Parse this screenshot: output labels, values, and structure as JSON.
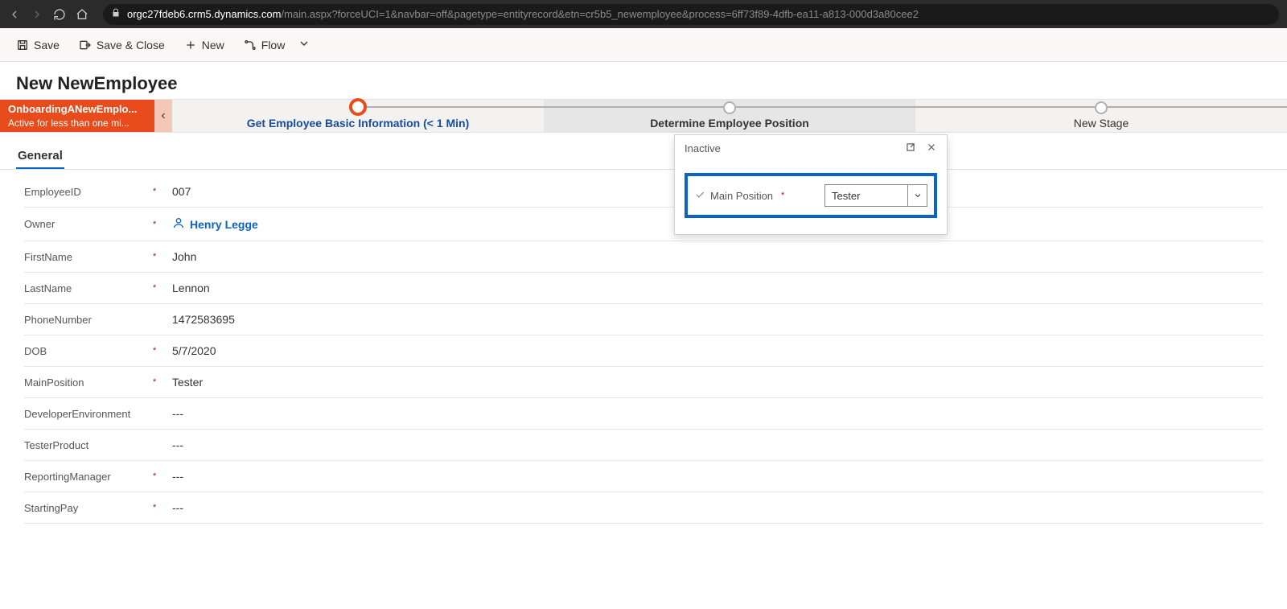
{
  "browser": {
    "url_domain": "orgc27fdeb6.crm5.dynamics.com",
    "url_path": "/main.aspx?forceUCI=1&navbar=off&pagetype=entityrecord&etn=cr5b5_newemployee&process=6ff73f89-4dfb-ea11-a813-000d3a80cee2"
  },
  "toolbar": {
    "save": "Save",
    "save_close": "Save & Close",
    "new": "New",
    "flow": "Flow"
  },
  "page_title": "New NewEmployee",
  "process": {
    "name": "OnboardingANewEmplo...",
    "status": "Active for less than one mi...",
    "stages": [
      {
        "label": "Get Employee Basic Information  (< 1 Min)",
        "state": "current"
      },
      {
        "label": "Determine Employee Position",
        "state": "active"
      },
      {
        "label": "New Stage",
        "state": "future"
      }
    ]
  },
  "stage_popup": {
    "status": "Inactive",
    "field_label": "Main Position",
    "field_value": "Tester"
  },
  "tabs": [
    {
      "label": "General",
      "active": true
    }
  ],
  "form": {
    "rows": [
      {
        "label": "EmployeeID",
        "required": true,
        "value": "007"
      },
      {
        "label": "Owner",
        "required": true,
        "value": "Henry Legge",
        "is_owner": true
      },
      {
        "label": "FirstName",
        "required": true,
        "value": "John"
      },
      {
        "label": "LastName",
        "required": true,
        "value": "Lennon"
      },
      {
        "label": "PhoneNumber",
        "required": false,
        "value": "1472583695"
      },
      {
        "label": "DOB",
        "required": true,
        "value": "5/7/2020"
      },
      {
        "label": "MainPosition",
        "required": true,
        "value": "Tester"
      },
      {
        "label": "DeveloperEnvironment",
        "required": false,
        "value": "---"
      },
      {
        "label": "TesterProduct",
        "required": false,
        "value": "---"
      },
      {
        "label": "ReportingManager",
        "required": true,
        "value": "---"
      },
      {
        "label": "StartingPay",
        "required": true,
        "value": "---"
      }
    ]
  },
  "required_marker": "*"
}
